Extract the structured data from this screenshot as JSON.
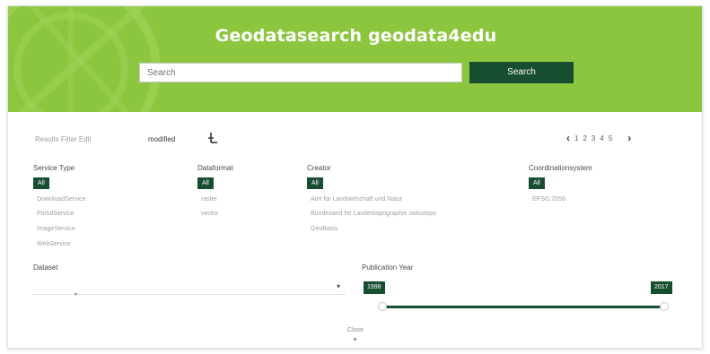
{
  "header": {
    "title": "Geodatasearch geodata4edu",
    "search_placeholder": "Search",
    "search_button": "Search"
  },
  "results": {
    "label": "Results Filter Edit",
    "sort_value": "modified",
    "pages": [
      "1",
      "2",
      "3",
      "4",
      "5"
    ]
  },
  "filters": {
    "all_label": "All",
    "service_type": {
      "title": "Service Type",
      "options": [
        "DownloadService",
        "PortalService",
        "ImageService",
        "WebService"
      ]
    },
    "dataformat": {
      "title": "Dataformat",
      "options": [
        "raster",
        "vector"
      ]
    },
    "creator": {
      "title": "Creator",
      "options": [
        "Amt für Landwirtschaft und Natur",
        "Bundesamt für Landestopographie swisstopo",
        "GeoBasis"
      ]
    },
    "coordinate_system": {
      "title": "Coordinationsystem",
      "options": [
        "EPSG:2056"
      ]
    }
  },
  "dataset": {
    "title": "Dataset",
    "value": ""
  },
  "publication_year": {
    "title": "Publication Year",
    "min": "1998",
    "max": "2017",
    "range_start": 0.0,
    "range_end": 1.0
  },
  "close_label": "Close",
  "colors": {
    "banner": "#8cc63f",
    "accent": "#174d31"
  }
}
